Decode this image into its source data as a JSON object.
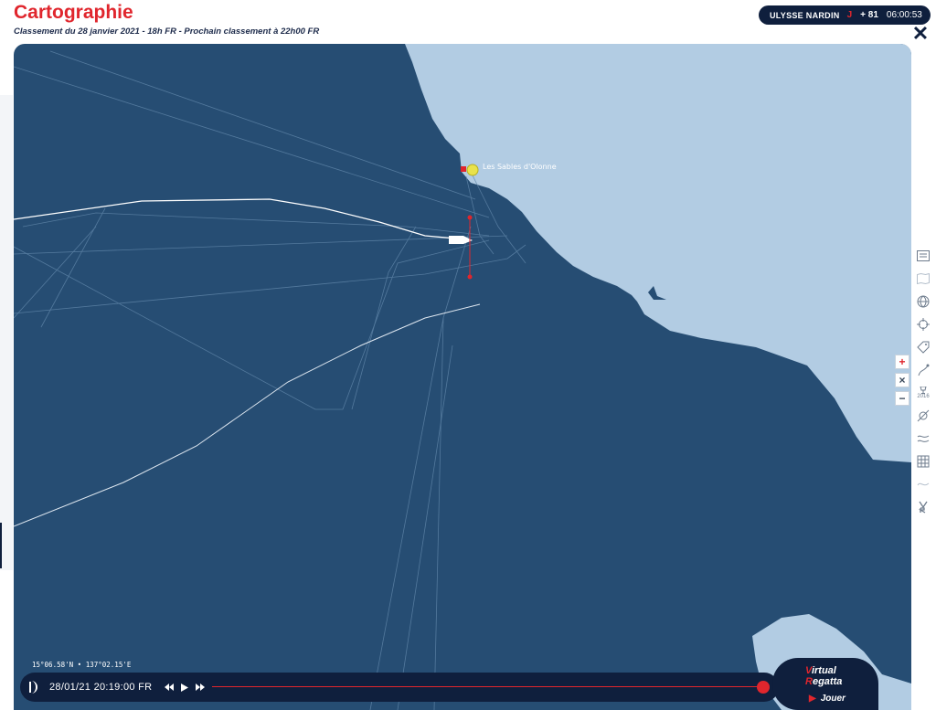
{
  "header": {
    "title": "Cartographie",
    "subtitle": "Classement du 28 janvier 2021 - 18h FR - Prochain classement à  22h00  FR"
  },
  "sponsor": {
    "brand": "ULYSSE NARDIN",
    "day_prefix": "J",
    "day_count": "+ 81",
    "elapsed": "06:00:53"
  },
  "map": {
    "port_label": "Les Sables d'Olonne",
    "coords": "15°06.58'N • 137°02.15'E",
    "colors": {
      "sea": "#264d73",
      "land": "#b2cce3",
      "route": "#ffffff",
      "accent": "#e0262d"
    }
  },
  "player": {
    "datetime": "28/01/21 20:19:00 FR",
    "progress": 1.0
  },
  "badge": {
    "line1": "Virtual",
    "line2": "Regatta",
    "play_label": "Jouer"
  },
  "zoom": {
    "plus": "+",
    "reset": "×",
    "minus": "−"
  },
  "toolbar": {
    "icons": [
      "ranking-icon",
      "map-icon",
      "globe-icon",
      "target-icon",
      "tag-icon",
      "route-icon",
      "trophy-icon",
      "wind-off-icon",
      "waves-icon",
      "grid-icon",
      "wave-icon",
      "vr-logo-icon"
    ],
    "trophy_year": "2016"
  }
}
